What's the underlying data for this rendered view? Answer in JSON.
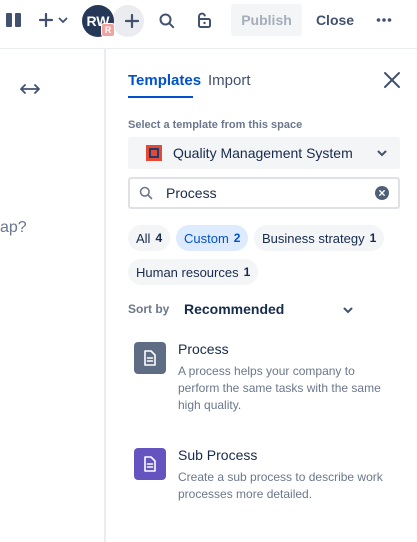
{
  "toolbar": {
    "avatar_initials": "RW",
    "avatar_badge": "R",
    "publish_label": "Publish",
    "close_label": "Close",
    "icons": {
      "sidebar_toggle": "sidebar-toggle-icon",
      "create": "plus-icon",
      "create_chevron": "chevron-down-icon",
      "invite": "plus-icon",
      "search": "search-icon",
      "restrictions": "unlock-icon",
      "more": "more-icon"
    }
  },
  "editor": {
    "text_fragment": "ap?",
    "icons": {
      "expand": "expand-width-icon"
    }
  },
  "panel": {
    "tabs": [
      {
        "label": "Templates",
        "active": true
      },
      {
        "label": "Import",
        "active": false
      }
    ],
    "space_label": "Select a template from this space",
    "space_name": "Quality Management System",
    "search": {
      "value": "Process"
    },
    "filters": [
      {
        "label": "All",
        "count": "4",
        "active": false
      },
      {
        "label": "Custom",
        "count": "2",
        "active": true
      },
      {
        "label": "Business strategy",
        "count": "1",
        "active": false
      },
      {
        "label": "Human resources",
        "count": "1",
        "active": false
      }
    ],
    "sort_label": "Sort by",
    "sort_value": "Recommended",
    "templates": [
      {
        "title": "Process",
        "description": "A process helps your company to perform the same tasks with the same high quality.",
        "color": "#5e6c84"
      },
      {
        "title": "Sub Process",
        "description": "Create a sub process to describe work processes more detailed.",
        "color": "#6554c0"
      }
    ]
  },
  "colors": {
    "accent": "#0052cc",
    "active_chip_bg": "#deebff",
    "avatar_bg": "#253858",
    "avatar_badge_bg": "#f0a4a0"
  }
}
